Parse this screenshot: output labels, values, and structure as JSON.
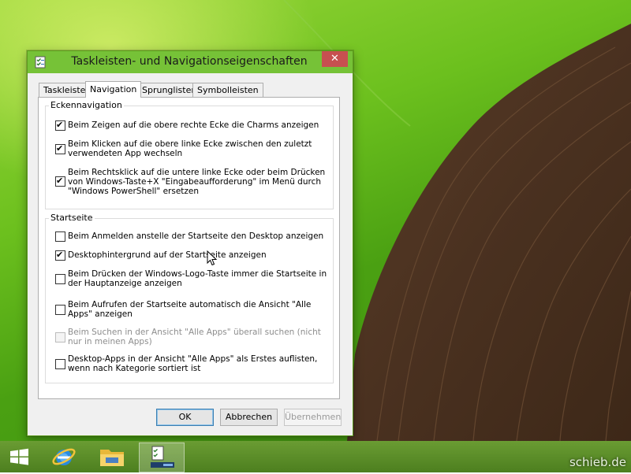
{
  "window": {
    "title": "Taskleisten- und Navigationseigenschaften",
    "close_glyph": "✕"
  },
  "tabs": [
    {
      "label": "Taskleiste",
      "active": false
    },
    {
      "label": "Navigation",
      "active": true
    },
    {
      "label": "Sprunglisten",
      "active": false
    },
    {
      "label": "Symbolleisten",
      "active": false
    }
  ],
  "groups": {
    "corner": {
      "title": "Eckennavigation",
      "options": [
        {
          "label": "Beim Zeigen auf die obere rechte Ecke die Charms anzeigen",
          "checked": true,
          "disabled": false
        },
        {
          "label": "Beim Klicken auf die obere linke Ecke zwischen den zuletzt verwendeten App wechseln",
          "checked": true,
          "disabled": false
        },
        {
          "label": "Beim Rechtsklick auf die untere linke Ecke oder beim Drücken von Windows-Taste+X \"Eingabeaufforderung\" im Menü durch \"Windows PowerShell\" ersetzen",
          "checked": true,
          "disabled": false
        }
      ]
    },
    "start": {
      "title": "Startseite",
      "options": [
        {
          "label": "Beim Anmelden anstelle der Startseite den Desktop anzeigen",
          "checked": false,
          "disabled": false
        },
        {
          "label": "Desktophintergrund auf der Startseite anzeigen",
          "checked": true,
          "disabled": false
        },
        {
          "label": "Beim Drücken der Windows-Logo-Taste immer die Startseite in der Hauptanzeige anzeigen",
          "checked": false,
          "disabled": false
        },
        {
          "label": "Beim Aufrufen der Startseite automatisch die Ansicht \"Alle Apps\" anzeigen",
          "checked": false,
          "disabled": false
        },
        {
          "label": "Beim Suchen in der Ansicht \"Alle Apps\" überall suchen (nicht nur in meinen Apps)",
          "checked": false,
          "disabled": true
        },
        {
          "label": "Desktop-Apps in der Ansicht \"Alle Apps\" als Erstes auflisten, wenn nach Kategorie sortiert ist",
          "checked": false,
          "disabled": false
        }
      ]
    }
  },
  "buttons": {
    "ok": "OK",
    "cancel": "Abbrechen",
    "apply": "Übernehmen"
  },
  "check_glyph": "✔",
  "taskbar": {
    "items": [
      {
        "name": "start-button",
        "icon": "windows-logo-icon"
      },
      {
        "name": "internet-explorer",
        "icon": "internet-explorer-icon"
      },
      {
        "name": "file-explorer",
        "icon": "folder-icon"
      },
      {
        "name": "properties-window",
        "icon": "checklist-icon",
        "active": true
      }
    ]
  },
  "watermark": "schieb.de"
}
